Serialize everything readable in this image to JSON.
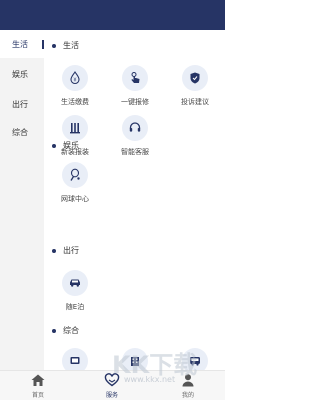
{
  "sidebar": {
    "items": [
      {
        "label": "生活"
      },
      {
        "label": "娱乐"
      },
      {
        "label": "出行"
      },
      {
        "label": "综合"
      }
    ]
  },
  "sections": [
    {
      "title": "生活",
      "tiles": [
        {
          "label": "生活缴费",
          "icon": "bill-pay-icon"
        },
        {
          "label": "一键报修",
          "icon": "hand-tap-icon"
        },
        {
          "label": "投诉建议",
          "icon": "shield-icon"
        },
        {
          "label": "新装报装",
          "icon": "install-icon"
        },
        {
          "label": "智能客服",
          "icon": "headset-icon"
        }
      ]
    },
    {
      "title": "娱乐",
      "tiles": [
        {
          "label": "网球中心",
          "icon": "tennis-racket-icon"
        }
      ]
    },
    {
      "title": "出行",
      "tiles": [
        {
          "label": "随E泊",
          "icon": "car-icon"
        }
      ]
    },
    {
      "title": "综合",
      "tiles": []
    }
  ],
  "tabs": [
    {
      "label": "首页",
      "icon": "home-icon"
    },
    {
      "label": "服务",
      "icon": "heart-hands-icon"
    },
    {
      "label": "我的",
      "icon": "person-icon"
    }
  ],
  "watermark": {
    "text": "KK下载",
    "url": "www.kkx.net"
  },
  "colors": {
    "primary": "#263465",
    "sidebar_bg": "#f3f3f3",
    "icon_bg": "#e9eef7"
  }
}
